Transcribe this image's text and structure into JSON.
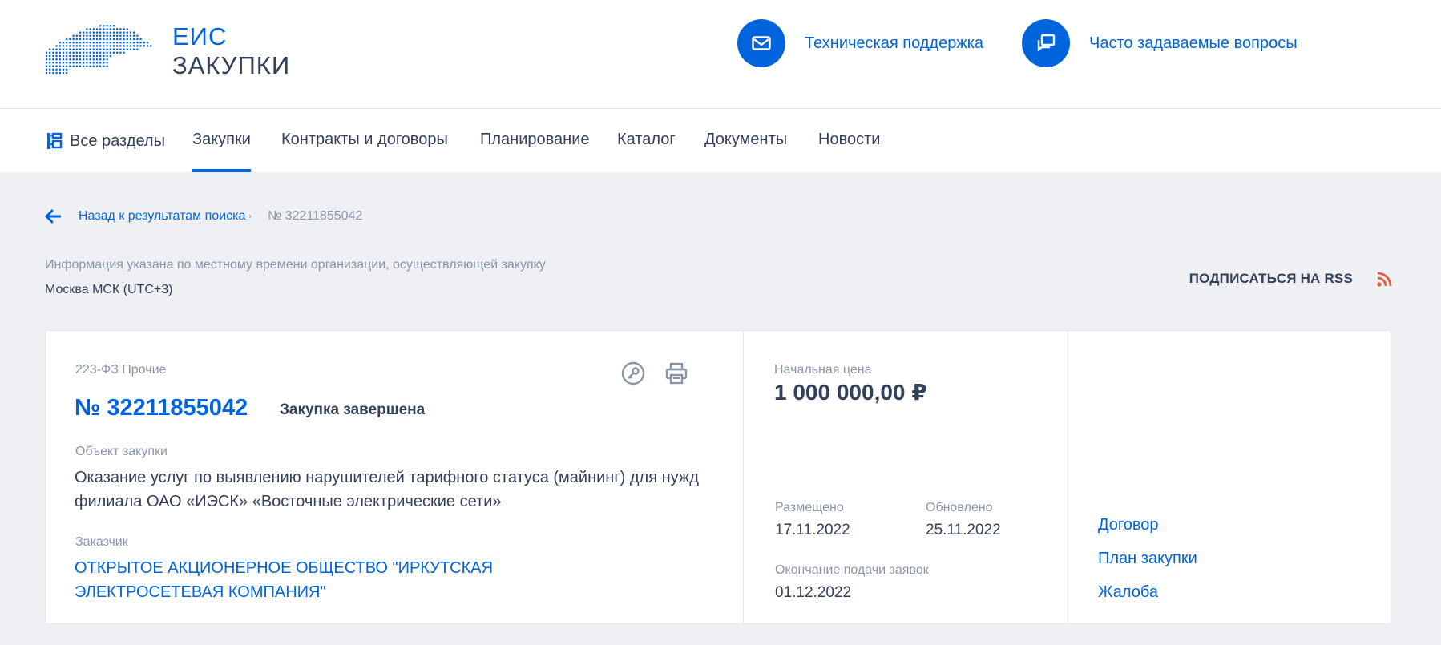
{
  "header": {
    "logo_line1": "ЕИС",
    "logo_line2": "ЗАКУПКИ",
    "support_label": "Техническая поддержка",
    "faq_label": "Часто задаваемые вопросы"
  },
  "nav": {
    "all_sections": "Все разделы",
    "items": [
      "Закупки",
      "Контракты и договоры",
      "Планирование",
      "Каталог",
      "Документы",
      "Новости"
    ],
    "active": "Закупки"
  },
  "breadcrumb": {
    "back_label": "Назад к результатам поиска",
    "current": "№ 32211855042"
  },
  "timezone": {
    "note": "Информация указана по местному времени организации, осуществляющей закупку",
    "value": "Москва МСК (UTC+3)"
  },
  "rss": {
    "label": "ПОДПИСАТЬСЯ НА RSS"
  },
  "purchase": {
    "law": "223-ФЗ Прочие",
    "number": "№ 32211855042",
    "status": "Закупка завершена",
    "object_label": "Объект закупки",
    "object_text": "Оказание услуг по выявлению нарушителей тарифного статуса (майнинг) для нужд филиала ОАО «ИЭСК» «Восточные электрические сети»",
    "customer_label": "Заказчик",
    "customer_text": "ОТКРЫТОЕ АКЦИОНЕРНОЕ ОБЩЕСТВО \"ИРКУТСКАЯ ЭЛЕКТРОСЕТЕВАЯ КОМПАНИЯ\"",
    "price_label": "Начальная цена",
    "price": "1 000 000,00 ₽",
    "posted_label": "Размещено",
    "posted_date": "17.11.2022",
    "updated_label": "Обновлено",
    "updated_date": "25.11.2022",
    "deadline_label": "Окончание подачи заявок",
    "deadline_date": "01.12.2022"
  },
  "side_links": [
    "Договор",
    "План закупки",
    "Жалоба"
  ],
  "colors": {
    "accent": "#0065dd",
    "text": "#334059",
    "muted": "#8a96a8",
    "rss": "#e8593b",
    "background": "#eef0f3"
  }
}
